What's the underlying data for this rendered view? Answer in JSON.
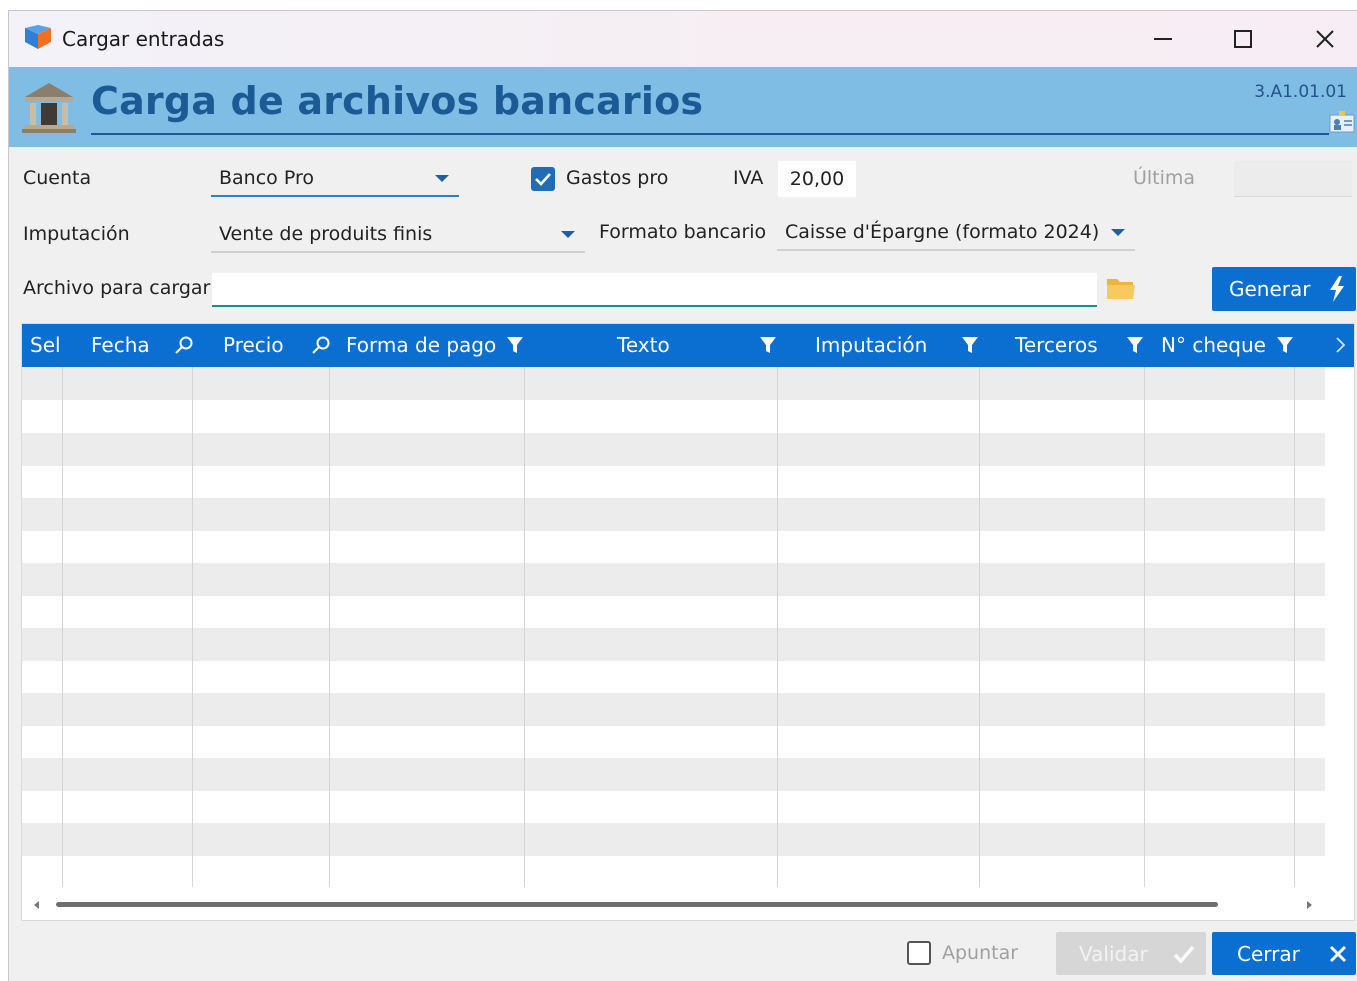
{
  "window": {
    "title": "Cargar entradas"
  },
  "header": {
    "title": "Carga de archivos bancarios",
    "version": "3.A1.01.01"
  },
  "form": {
    "cuenta_label": "Cuenta",
    "cuenta_value": "Banco Pro",
    "gastos_pro_label": "Gastos pro",
    "gastos_pro_checked": true,
    "iva_label": "IVA",
    "iva_value": "20,00",
    "ultima_label": "Última",
    "ultima_value": "",
    "imputacion_label": "Imputación",
    "imputacion_value": "Vente de produits finis",
    "formato_label": "Formato bancario",
    "formato_value": "Caisse d'Épargne (formato 2024)",
    "archivo_label": "Archivo para cargar",
    "archivo_value": "",
    "generar_label": "Generar"
  },
  "grid": {
    "columns": [
      "Sel",
      "Fecha",
      "Precio",
      "Forma de pago",
      "Texto",
      "Imputación",
      "Terceros",
      "N° cheque"
    ],
    "rows": []
  },
  "footer": {
    "apuntar_label": "Apuntar",
    "apuntar_checked": false,
    "validar_label": "Validar",
    "cerrar_label": "Cerrar"
  },
  "colors": {
    "accent": "#0a6fd1",
    "header_band": "#80bde4",
    "title_text": "#1c5a96"
  }
}
